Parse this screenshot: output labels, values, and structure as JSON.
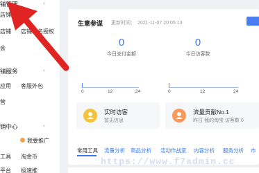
{
  "sidebar": {
    "section1_title": "铺管理",
    "items_row1": [
      "图",
      "店铺"
    ],
    "items_row2": [
      "店铺",
      "店铺域名授权"
    ],
    "items_row3": [
      "会"
    ],
    "section2_title": "铺服务",
    "items_row4": [
      "应用",
      "客服外包"
    ],
    "items_row5": [
      "营"
    ],
    "section3_title": "销中心",
    "items_row6": [
      "我要推广"
    ],
    "items_row7": [
      "工具",
      "淘金币"
    ],
    "items_row8": [
      "平台",
      "极速推"
    ]
  },
  "card": {
    "title": "生意参谋",
    "updated_label": "更新时间：",
    "updated_time": "2021-11-07 20:05:13",
    "metrics": [
      {
        "value": "0",
        "label": "今日支付金额"
      },
      {
        "value": "0",
        "label": "今日访客数"
      }
    ],
    "axis_ticks": [
      "0",
      "12",
      "24"
    ],
    "info": [
      {
        "title": "实时访客",
        "sub": "暂无信息",
        "icon": "user-icon",
        "color": "#f5c23d"
      },
      {
        "title": "流量贡献No.1",
        "sub": "昨日 我的淘宝 访客数 0",
        "icon": "user-icon",
        "color": "#f59a5a"
      }
    ],
    "tabs": [
      "常用工具",
      "流量分析",
      "商品分析",
      "活动作战室",
      "内容分析",
      "服务分析",
      "市"
    ],
    "accent": "#3c78e8"
  },
  "watermark": "https://www.f7admin.cc"
}
